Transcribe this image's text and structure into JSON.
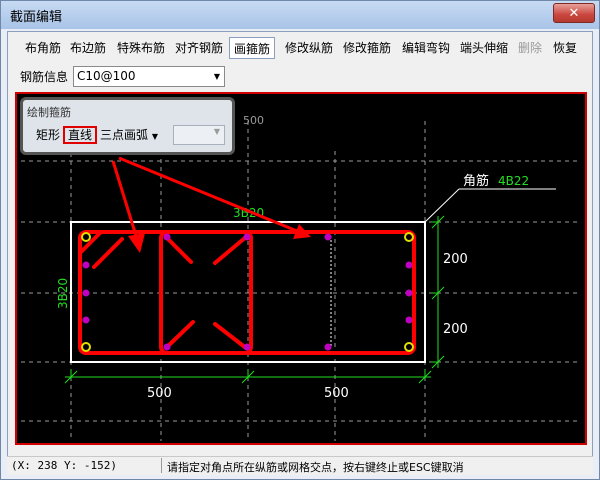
{
  "window": {
    "title": "截面编辑",
    "close_glyph": "✕"
  },
  "toolbar": {
    "items": [
      {
        "label": "布角筋",
        "state": "normal"
      },
      {
        "label": "布边筋",
        "state": "normal"
      },
      {
        "label": "特殊布筋",
        "state": "normal"
      },
      {
        "label": "对齐钢筋",
        "state": "normal"
      },
      {
        "label": "画箍筋",
        "state": "active"
      },
      {
        "label": "修改纵筋",
        "state": "normal"
      },
      {
        "label": "修改箍筋",
        "state": "normal"
      },
      {
        "label": "编辑弯钩",
        "state": "normal"
      },
      {
        "label": "端头伸缩",
        "state": "normal"
      },
      {
        "label": "删除",
        "state": "disabled"
      },
      {
        "label": "恢复",
        "state": "normal"
      }
    ]
  },
  "rebar_info": {
    "label": "钢筋信息",
    "value": "C10@100"
  },
  "draw_palette": {
    "title": "绘制箍筋",
    "buttons": {
      "rect": "矩形",
      "line": "直线",
      "arc": "三点画弧"
    }
  },
  "drawing": {
    "grid_label": "500",
    "corner_bar_label": "角筋",
    "corner_bar_value": "4B22",
    "top_bar_label": "3B20",
    "side_bar_label": "3B20",
    "dim_right_top": "200",
    "dim_right_bottom": "200",
    "dim_bottom_left": "500",
    "dim_bottom_right": "500",
    "colors": {
      "section": "#ffffff",
      "grid": "#9a9a9a",
      "rebar_label": "#22dd22",
      "stirrup": "#ff0000",
      "bar_magenta": "#c000c0",
      "bar_yellow": "#e0e000"
    }
  },
  "status": {
    "coord": "(X: 238 Y: -152)",
    "message": "请指定对角点所在纵筋或网格交点，按右键终止或ESC键取消"
  }
}
